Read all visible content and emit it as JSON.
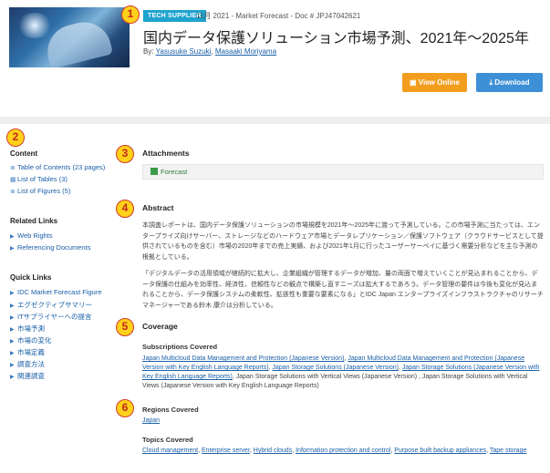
{
  "markers": [
    "1",
    "2",
    "3",
    "4",
    "5",
    "6"
  ],
  "header": {
    "tag": "TECH SUPPLIER",
    "meta": "11月 2021 - Market Forecast - Doc # JPJ47042621",
    "title": "国内データ保護ソリューション市場予測、2021年～2025年",
    "by_label": "By:",
    "author1": "Yasusuke Suzuki",
    "author_sep": ",",
    "author2": "Masaaki Moriyama",
    "view_online": "View Online",
    "download": "Download"
  },
  "sidebar": {
    "content_heading": "Content",
    "content_links": [
      "Table of Contents (23 pages)",
      "List of Tables (3)",
      "List of Figures (5)"
    ],
    "related_heading": "Related Links",
    "related_links": [
      "Web Rights",
      "Referencing Documents"
    ],
    "quick_heading": "Quick Links",
    "quick_links": [
      "IDC Market Forecast Figure",
      "エグゼクティブサマリー",
      "ITサプライヤーへの提言",
      "市場予測",
      "市場の変化",
      "市場定義",
      "調査方法",
      "関連調査"
    ]
  },
  "main": {
    "attachments_heading": "Attachments",
    "attachment_link": "Forecast",
    "abstract_heading": "Abstract",
    "abstract_p1": "本調査レポートは、国内データ保護ソリューションの市場規模を2021年～2025年に渡って予測している。この市場予測に当たっては、エンタープライズ向けサーバー、ストレージなどのハードウェア市場とデータレプリケーション／保護ソフトウェア（クラウドサービスとして提供されているものを含む）市場の2020年までの売上実績、および2021年1月に行ったユーザーサーベイに基づく需要分析などを主な予測の根拠としている。",
    "abstract_p2": "「デジタルデータの活用領域が継続的に拡大し、企業組織が管理するデータが増加、量の両面で増えていくことが見込まれることから、データ保護の仕組みを効率性、経済性、信頼性などの観点で構築し直すニーズは拡大するであろう。データ管理の要件は今後も変化が見込まれることから、データ保護システムの柔軟性、拡張性も重要な要素になる」とIDC Japan エンタープライズインフラストラクチャのリサーチマネージャーである鈴木 康介は分析している。",
    "coverage_heading": "Coverage",
    "subs_heading": "Subscriptions Covered",
    "sub1": "Japan Multicloud Data Management and Protection (Japanese Version)",
    "sub2": "Japan Multicloud Data Management and Protection (Japanese Version with Key English Language Reports)",
    "sub3": "Japan Storage Solutions (Japanese Version)",
    "sub4": "Japan Storage Solutions (Japanese Version with Key English Language Reports)",
    "sub_tail": ", Japan Storage Solutions with Vertical Views (Japanese Version) , Japan Storage Solutions with Vertical Views (Japanese Version with Key English Language Reports)",
    "regions_heading": "Regions Covered",
    "region1": "Japan",
    "topics_heading": "Topics Covered",
    "topics": [
      "Cloud management",
      "Enterprise server",
      "Hybrid clouds",
      "Information protection and control",
      "Purpose built backup appliances",
      "Tape storage"
    ]
  }
}
